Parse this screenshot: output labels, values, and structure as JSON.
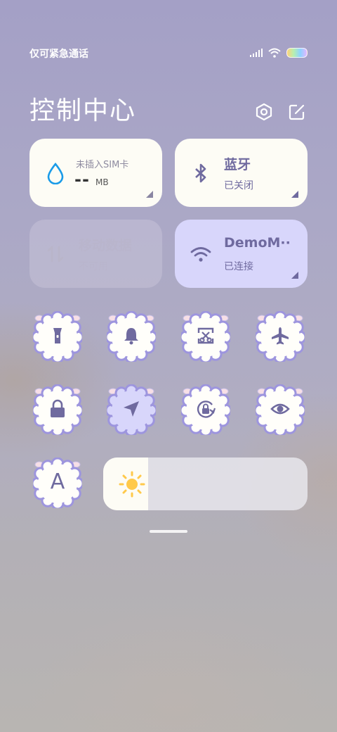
{
  "status_bar": {
    "carrier": "仅可紧急通话"
  },
  "header": {
    "title": "控制中心"
  },
  "tiles": {
    "data": {
      "title": "未插入SIM卡",
      "value": "--",
      "unit": "MB"
    },
    "bluetooth": {
      "title": "蓝牙",
      "status": "已关闭"
    },
    "mobile_data": {
      "title": "移动数据",
      "status": "不可用"
    },
    "wifi": {
      "title": "DemoM··",
      "status": "已连接"
    }
  },
  "toggles": [
    "flashlight-icon",
    "bell-icon",
    "screenshot-icon",
    "airplane-icon",
    "lock-icon",
    "location-icon",
    "rotation-lock-icon",
    "eye-icon",
    "font-icon"
  ],
  "toggles_letter": "A",
  "brightness": {
    "level": 0.22
  },
  "colors": {
    "accent": "#6f6a9f",
    "tile_white": "#fdfcf5",
    "tile_active": "#d8d6fb"
  }
}
